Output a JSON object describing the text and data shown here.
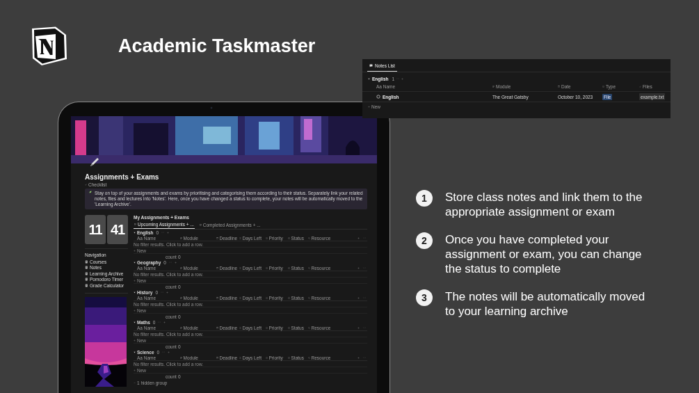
{
  "brand": {
    "title": "Academic Taskmaster"
  },
  "notes_panel": {
    "tabs": [
      {
        "label": "Notes List",
        "selected": true
      }
    ],
    "group": {
      "name": "English",
      "count": "1"
    },
    "columns": [
      {
        "label": "Aa Name",
        "kind": "text"
      },
      {
        "label": "Module",
        "kind": "lines"
      },
      {
        "label": "Date",
        "kind": "date"
      },
      {
        "label": "Type",
        "kind": "select"
      },
      {
        "label": "Files",
        "kind": "clip"
      }
    ],
    "rows": [
      {
        "name": "English",
        "module": "The Great Gatsby",
        "date": "October 10, 2023",
        "type": "File",
        "files": "example.txt"
      }
    ],
    "new_label": "New"
  },
  "tablet": {
    "page": {
      "title": "Assignments + Exams",
      "subtitle": "Checklist",
      "callout": "Stay on top of your assignments and exams by prioritising and categorising them according to their status. Separately link your related notes, files and lectures into 'Notes'. Here, once you have changed a status to complete, your notes will be automatically moved to the 'Learning Archive'.",
      "clock": {
        "hours": "11",
        "minutes": "41"
      },
      "navigation": {
        "heading": "Navigation",
        "items": [
          {
            "label": "Courses"
          },
          {
            "label": "Notes"
          },
          {
            "label": "Learning Archive"
          },
          {
            "label": "Pomodoro Timer"
          },
          {
            "label": "Grade Calculator"
          }
        ]
      },
      "database": {
        "title": "My Assignments + Exams",
        "tabs": [
          {
            "label": "Upcoming Assignments + ...",
            "selected": true
          },
          {
            "label": "Completed Assignments + ...",
            "selected": false
          }
        ],
        "groups": [
          {
            "name": "English",
            "count": "0",
            "columns": [
              {
                "label": "Aa Name",
                "kind": "text"
              },
              {
                "label": "Module",
                "kind": "lines"
              },
              {
                "label": "Deadline",
                "kind": "date"
              },
              {
                "label": "Days Left",
                "kind": "formula"
              },
              {
                "label": "Priority",
                "kind": "select"
              },
              {
                "label": "Status",
                "kind": "status"
              },
              {
                "label": "Resource",
                "kind": "relation"
              }
            ],
            "empty_text": "No filter results. Click to add a row.",
            "new_label": "New",
            "count_label": "count",
            "count_value": "0"
          },
          {
            "name": "Geography",
            "count": "0",
            "columns": [
              {
                "label": "Aa Name",
                "kind": "text"
              },
              {
                "label": "Module",
                "kind": "lines"
              },
              {
                "label": "Deadline",
                "kind": "date"
              },
              {
                "label": "Days Left",
                "kind": "formula"
              },
              {
                "label": "Priority",
                "kind": "select"
              },
              {
                "label": "Status",
                "kind": "status"
              },
              {
                "label": "Resource",
                "kind": "relation"
              }
            ],
            "empty_text": "No filter results. Click to add a row.",
            "new_label": "New",
            "count_label": "count",
            "count_value": "0"
          },
          {
            "name": "History",
            "count": "0",
            "columns": [
              {
                "label": "Aa Name",
                "kind": "text"
              },
              {
                "label": "Module",
                "kind": "lines"
              },
              {
                "label": "Deadline",
                "kind": "date"
              },
              {
                "label": "Days Left",
                "kind": "formula"
              },
              {
                "label": "Priority",
                "kind": "select"
              },
              {
                "label": "Status",
                "kind": "status"
              },
              {
                "label": "Resource",
                "kind": "relation"
              }
            ],
            "empty_text": "No filter results. Click to add a row.",
            "new_label": "New",
            "count_label": "count",
            "count_value": "0"
          },
          {
            "name": "Maths",
            "count": "0",
            "columns": [
              {
                "label": "Aa Name",
                "kind": "text"
              },
              {
                "label": "Module",
                "kind": "lines"
              },
              {
                "label": "Deadline",
                "kind": "date"
              },
              {
                "label": "Days Left",
                "kind": "formula"
              },
              {
                "label": "Priority",
                "kind": "select"
              },
              {
                "label": "Status",
                "kind": "status"
              },
              {
                "label": "Resource",
                "kind": "relation"
              }
            ],
            "empty_text": "No filter results. Click to add a row.",
            "new_label": "New",
            "count_label": "count",
            "count_value": "0"
          },
          {
            "name": "Science",
            "count": "0",
            "columns": [
              {
                "label": "Aa Name",
                "kind": "text"
              },
              {
                "label": "Module",
                "kind": "lines"
              },
              {
                "label": "Deadline",
                "kind": "date"
              },
              {
                "label": "Days Left",
                "kind": "formula"
              },
              {
                "label": "Priority",
                "kind": "select"
              },
              {
                "label": "Status",
                "kind": "status"
              },
              {
                "label": "Resource",
                "kind": "relation"
              }
            ],
            "empty_text": "No filter results. Click to add a row.",
            "new_label": "New",
            "count_label": "count",
            "count_value": "0"
          }
        ],
        "hidden_groups": "1 hidden group"
      }
    }
  },
  "features": [
    {
      "number": "1",
      "text": "Store class notes and link them to the appropriate assignment or exam"
    },
    {
      "number": "2",
      "text": "Once you have completed your assignment or exam, you can change the status to complete"
    },
    {
      "number": "3",
      "text": "The notes will be automatically moved to your learning archive"
    }
  ]
}
